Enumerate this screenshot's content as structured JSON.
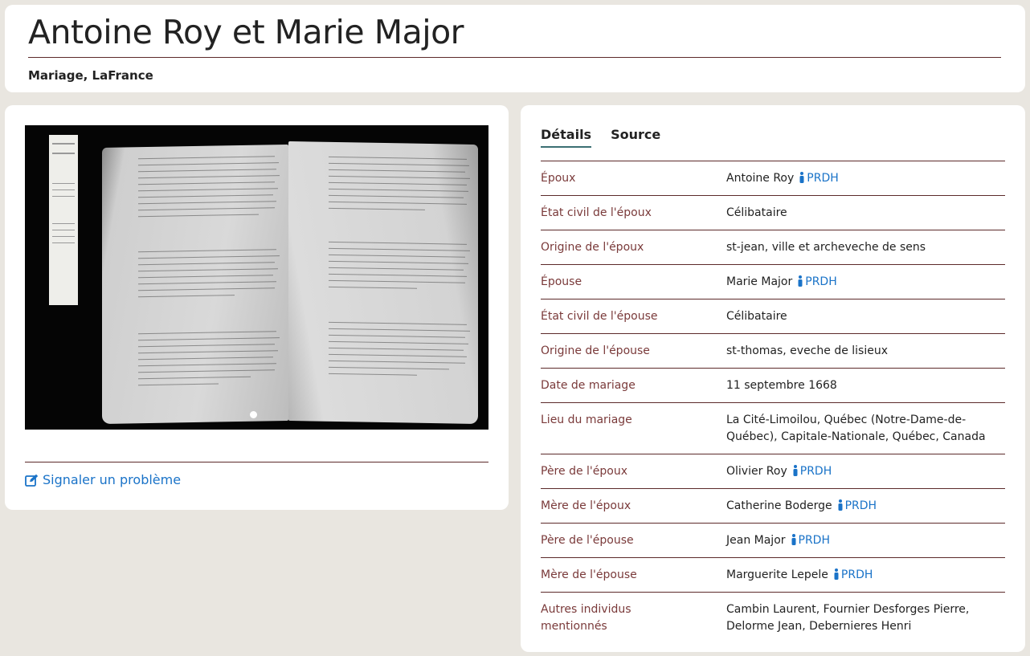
{
  "header": {
    "title": "Antoine Roy et Marie Major",
    "subtitle": "Mariage, LaFrance"
  },
  "image_card": {
    "report_label": "Signaler un problème"
  },
  "tabs": [
    {
      "label": "Détails",
      "active": true
    },
    {
      "label": "Source",
      "active": false
    }
  ],
  "details": {
    "prdh_label": "PRDH",
    "rows": [
      {
        "label": "Époux",
        "value": "Antoine Roy"
      },
      {
        "label": "État civil de l'époux",
        "value": "Célibataire"
      },
      {
        "label": "Origine de l'époux",
        "value": "st-jean, ville et archeveche de sens"
      },
      {
        "label": "Épouse",
        "value": "Marie Major"
      },
      {
        "label": "État civil de l'épouse",
        "value": "Célibataire"
      },
      {
        "label": "Origine de l'épouse",
        "value": "st-thomas, eveche de lisieux"
      },
      {
        "label": "Date de mariage",
        "value": "11 septembre 1668"
      },
      {
        "label": "Lieu du mariage",
        "value": "La Cité-Limoilou, Québec (Notre-Dame-de-Québec), Capitale-Nationale, Québec, Canada"
      },
      {
        "label": "Père de l'époux",
        "value": "Olivier Roy"
      },
      {
        "label": "Mère de l'époux",
        "value": "Catherine Boderge"
      },
      {
        "label": "Père de l'épouse",
        "value": "Jean Major"
      },
      {
        "label": "Mère de l'épouse",
        "value": "Marguerite Lepele"
      },
      {
        "label": "Autres individus mentionnés",
        "value": "Cambin Laurent, Fournier Desforges Pierre, Delorme Jean, Debernieres Henri"
      }
    ]
  },
  "colors": {
    "background": "#e9e6e0",
    "label": "#7a3a3a",
    "link": "#1a73c8",
    "rule": "#5c2a2a"
  }
}
